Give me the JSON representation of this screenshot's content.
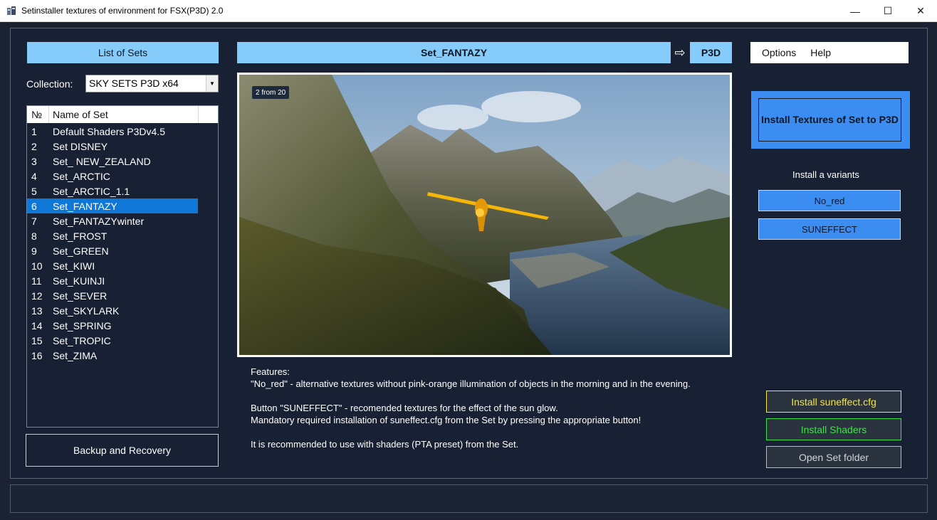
{
  "window": {
    "title": "Setinstaller textures of environment for FSX(P3D) 2.0",
    "icon": "app-icon",
    "controls": {
      "minimize": "—",
      "maximize": "☐",
      "close": "✕"
    }
  },
  "header": {
    "list_of_sets": "List of Sets",
    "set_title": "Set_FANTAZY",
    "arrow": "⇨",
    "target": "P3D"
  },
  "menu": {
    "options": "Options",
    "help": "Help"
  },
  "collection": {
    "label": "Collection:",
    "value": "SKY SETS P3D x64"
  },
  "list": {
    "col_num": "№",
    "col_name": "Name of Set",
    "selected_index": 5,
    "rows": [
      {
        "num": "1",
        "name": "Default Shaders P3Dv4.5"
      },
      {
        "num": "2",
        "name": "Set DISNEY"
      },
      {
        "num": "3",
        "name": "Set_ NEW_ZEALAND"
      },
      {
        "num": "4",
        "name": "Set_ARCTIC"
      },
      {
        "num": "5",
        "name": "Set_ARCTIC_1.1"
      },
      {
        "num": "6",
        "name": "Set_FANTAZY"
      },
      {
        "num": "7",
        "name": "Set_FANTAZYwinter"
      },
      {
        "num": "8",
        "name": "Set_FROST"
      },
      {
        "num": "9",
        "name": "Set_GREEN"
      },
      {
        "num": "10",
        "name": "Set_KIWI"
      },
      {
        "num": "11",
        "name": "Set_KUINJI"
      },
      {
        "num": "12",
        "name": "Set_SEVER"
      },
      {
        "num": "13",
        "name": "Set_SKYLARK"
      },
      {
        "num": "14",
        "name": "Set_SPRING"
      },
      {
        "num": "15",
        "name": "Set_TROPIC"
      },
      {
        "num": "16",
        "name": "Set_ZIMA"
      }
    ]
  },
  "backup_button": "Backup and Recovery",
  "preview": {
    "counter": "2 from 20"
  },
  "features": {
    "heading": "Features:",
    "line1": "\"No_red\" - alternative textures without pink-orange illumination of objects in the morning and in the evening.",
    "line2": "Button  \"SUNEFFECT\" - recomended textures for the effect of the sun glow.",
    "line3": "Mandatory required installation of suneffect.cfg from the Set by pressing the appropriate button!",
    "line4": "It is recommended to use with shaders (PTA preset) from the Set."
  },
  "install": {
    "main": "Install Textures of Set to P3D",
    "variants_label": "Install a variants",
    "variant1": "No_red",
    "variant2": "SUNEFFECT",
    "suneffect": "Install suneffect.cfg",
    "shaders": "Install Shaders",
    "open_folder": "Open Set folder"
  },
  "colors": {
    "background": "#1b2332",
    "accent_light": "#86ccfb",
    "accent_blue": "#3b8df1",
    "selection": "#0f78d6",
    "yellow": "#f5e63c",
    "green": "#3ee04a"
  }
}
